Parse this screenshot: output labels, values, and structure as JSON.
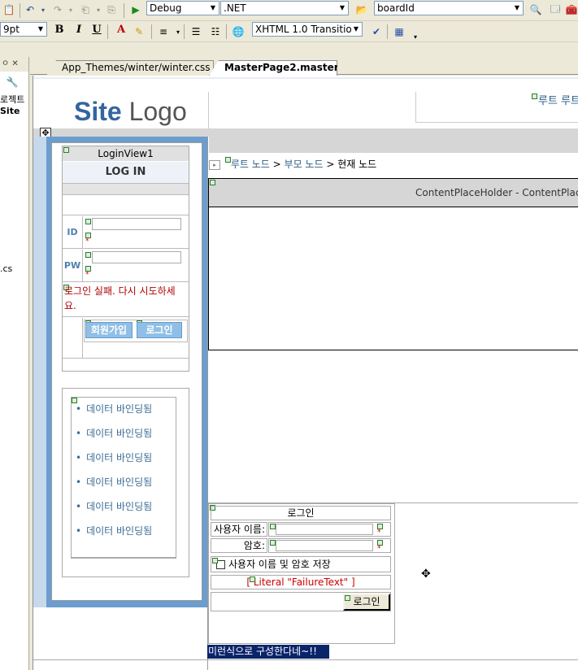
{
  "toolbar1": {
    "solution_config": "Debug",
    "platform": ".NET",
    "find_text": "boardId"
  },
  "toolbar2": {
    "font_size": "9pt",
    "doctype": "XHTML 1.0 Transitio"
  },
  "left_panel": {
    "header": "ㅇ ✕",
    "items": [
      "로젝트",
      "Site"
    ],
    "extension": ".cs"
  },
  "tabs": [
    {
      "label": "App_Themes/winter/winter.css",
      "active": false
    },
    {
      "label": "MasterPage2.master*",
      "active": true
    }
  ],
  "design": {
    "logo_bold": "Site",
    "logo_rest": " Logo",
    "top_right_link": "루트 루트",
    "breadcrumb": {
      "root": "루트 노드",
      "parent": "부모 노드",
      "current": "현재 노드",
      "sep": ">"
    },
    "content_placeholder": "ContentPlaceHolder - ContentPlaceH",
    "loginview": {
      "title": "LoginView1",
      "heading": "LOG IN",
      "id_label": "ID",
      "pw_label": "PW",
      "error": "로그인 실패. 다시 시도하세요.",
      "signup_button": "회원가입",
      "login_button": "로그인"
    },
    "datalist": {
      "items": [
        "데이터 바인딩됨",
        "데이터 바인딩됨",
        "데이터 바인딩됨",
        "데이터 바인딩됨",
        "데이터 바인딩됨",
        "데이터 바인딩됨"
      ]
    },
    "login_control": {
      "title": "로그인",
      "username_label": "사용자 이름:",
      "password_label": "암호:",
      "remember": "사용자 이름 및 암호 저장",
      "failure_text": "[ Literal \"FailureText\" ]",
      "login_button": "로그인",
      "star": "*"
    },
    "footer_text": "미런식으로 구성한다네~!!"
  }
}
